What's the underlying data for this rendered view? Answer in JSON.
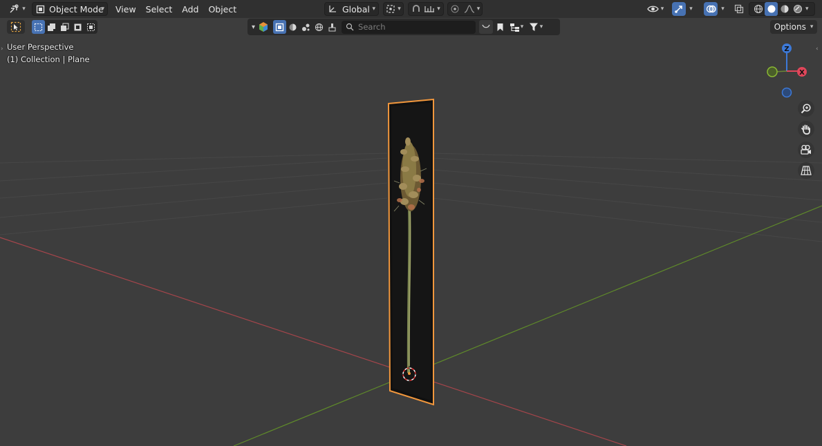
{
  "header": {
    "mode_label": "Object Mode",
    "menus": [
      "View",
      "Select",
      "Add",
      "Object"
    ],
    "orientation_label": "Global",
    "icons": [
      "editor-type-icon",
      "object-mode-icon",
      "transform-orientation-icon",
      "pivot-icon",
      "snap-icon",
      "snap-increment-icon",
      "proportional-edit-icon",
      "falloff-icon",
      "visibility-icon",
      "gizmo-icon",
      "overlay-icon",
      "xray-icon",
      "wireframe-shading-icon",
      "solid-shading-icon",
      "material-shading-icon",
      "rendered-shading-icon"
    ]
  },
  "toolbar": {
    "search_placeholder": "Search",
    "options_label": "Options"
  },
  "viewport": {
    "perspective_label": "User Perspective",
    "collection_label": "(1) Collection | Plane"
  },
  "gizmo": {
    "axes": [
      "Z",
      "X"
    ],
    "colors": {
      "x": "#e0465a",
      "y": "#8ab833",
      "z": "#3d7ad9"
    }
  },
  "navigation": [
    "zoom-icon",
    "pan-hand-icon",
    "camera-icon",
    "grid-view-icon"
  ],
  "colors": {
    "background": "#3d3d3d",
    "header": "#303030",
    "accent": "#4772b3",
    "selection_outline": "#f29a3d",
    "x_axis": "#b84b4f",
    "y_axis": "#6b9a2d"
  }
}
